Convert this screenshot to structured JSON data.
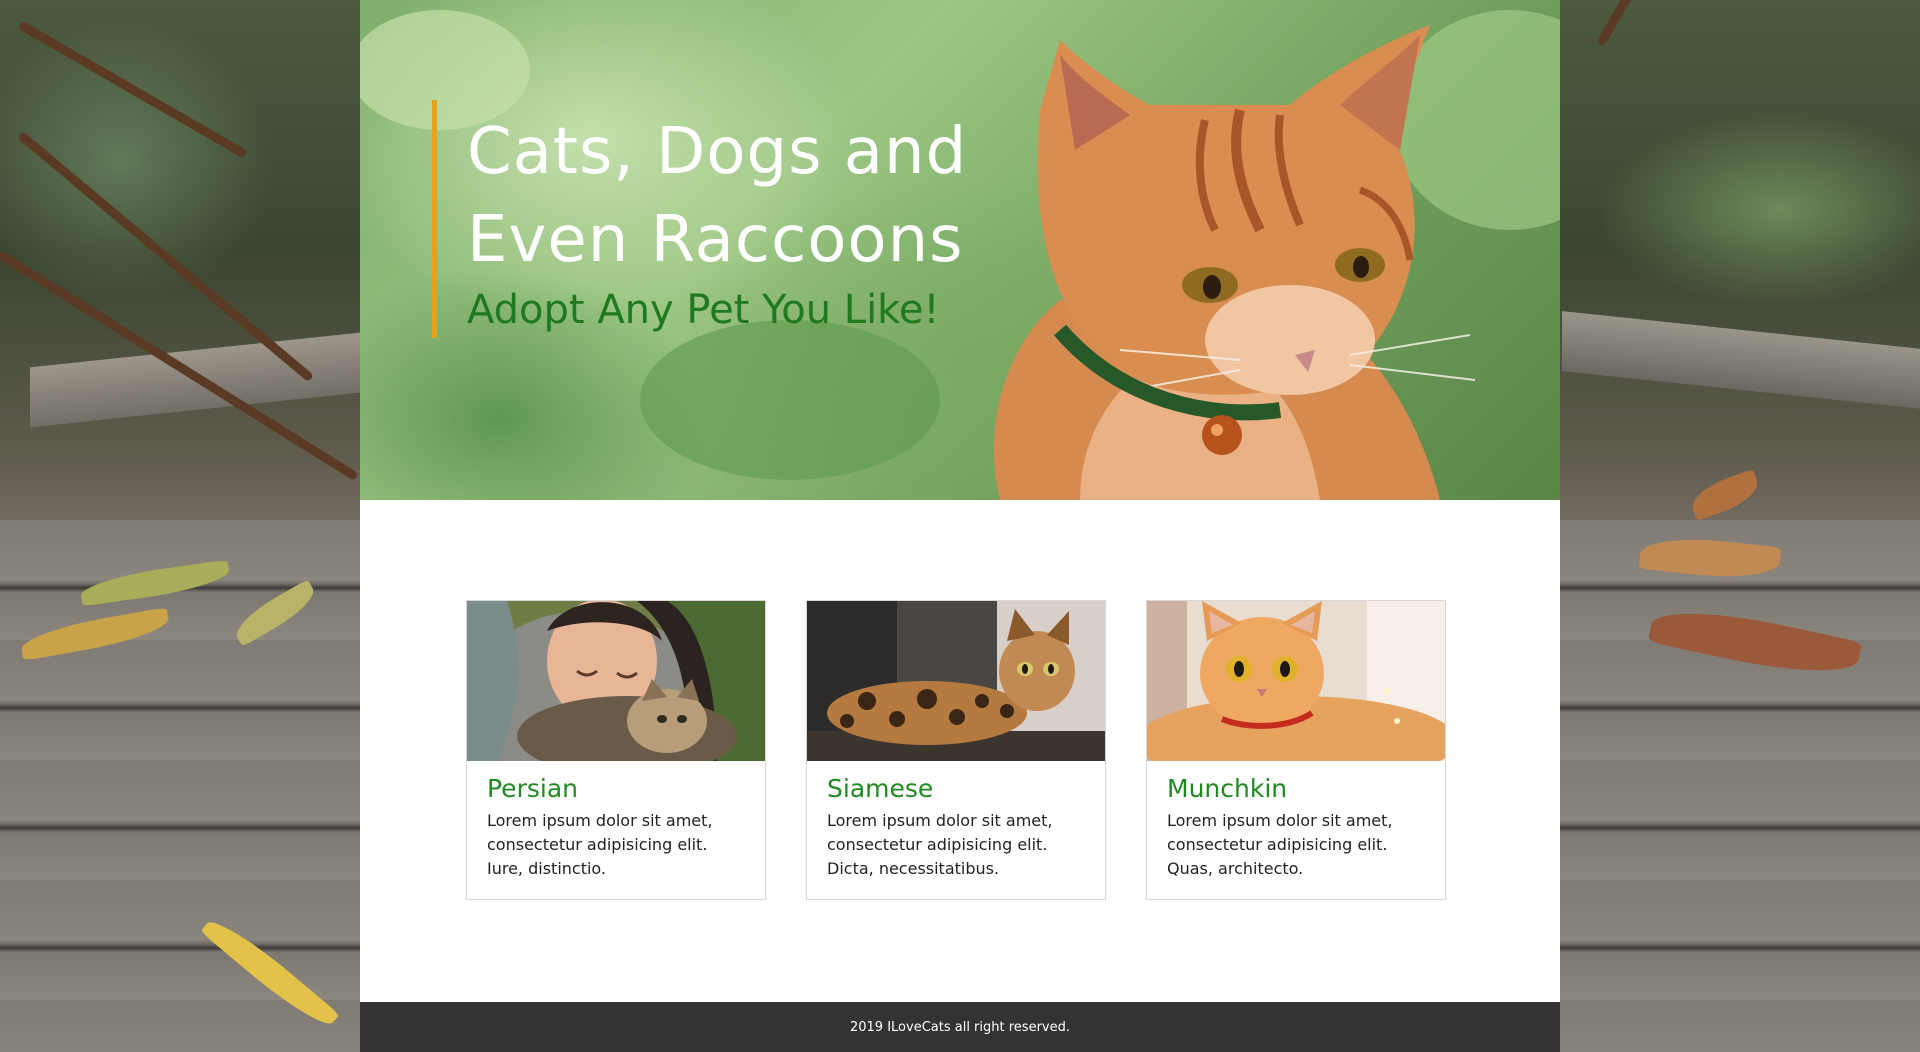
{
  "hero": {
    "title": "Cats, Dogs and Even Raccoons",
    "subtitle": "Adopt Any Pet You Like!"
  },
  "cards": [
    {
      "title": "Persian",
      "text": "Lorem ipsum dolor sit amet, consectetur adipisicing elit. Iure, distinctio."
    },
    {
      "title": "Siamese",
      "text": "Lorem ipsum dolor sit amet, consectetur adipisicing elit. Dicta, necessitatibus."
    },
    {
      "title": "Munchkin",
      "text": "Lorem ipsum dolor sit amet, consectetur adipisicing elit. Quas, architecto."
    }
  ],
  "footer": {
    "text": "2019 ILoveCats all right reserved."
  },
  "colors": {
    "accent_bar": "#e8a21a",
    "subtitle_green": "#1f7a1f",
    "card_title_green": "#1f8a1f",
    "footer_bg": "#333333"
  }
}
